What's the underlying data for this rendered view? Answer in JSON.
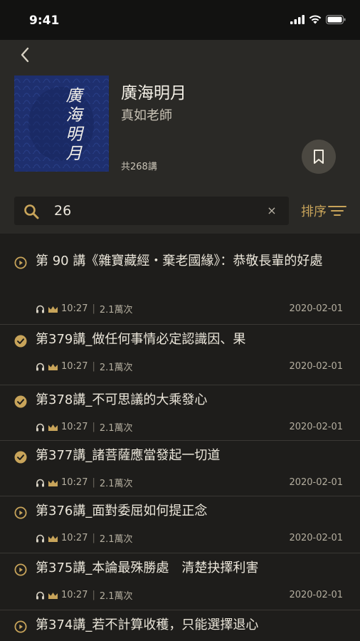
{
  "status": {
    "time": "9:41"
  },
  "album": {
    "title": "廣海明月",
    "author": "真如老師",
    "count": "共268講",
    "cover_text": "廣海明月"
  },
  "search": {
    "value": "26",
    "clear": "×",
    "sort_label": "排序"
  },
  "colors": {
    "accent": "#c8a45a",
    "background": "#1e1d1b",
    "header": "#2a2926",
    "cover": "#1e2f6e"
  },
  "episodes": [
    {
      "title": "第 90 講《雜寶藏經・棄老國緣》：恭敬長輩的好處",
      "duration": "10:27",
      "plays": "2.1萬次",
      "date": "2020-02-01",
      "status": "play"
    },
    {
      "title": "第379講_做任何事情必定認識因、果",
      "duration": "10:27",
      "plays": "2.1萬次",
      "date": "2020-02-01",
      "status": "done"
    },
    {
      "title": "第378講_不可思議的大乘發心",
      "duration": "10:27",
      "plays": "2.1萬次",
      "date": "2020-02-01",
      "status": "done"
    },
    {
      "title": "第377講_諸菩薩應當發起一切道",
      "duration": "10:27",
      "plays": "2.1萬次",
      "date": "2020-02-01",
      "status": "done"
    },
    {
      "title": "第376講_面對委屈如何提正念",
      "duration": "10:27",
      "plays": "2.1萬次",
      "date": "2020-02-01",
      "status": "play"
    },
    {
      "title": "第375講_本論最殊勝處　清楚抉擇利害",
      "duration": "10:27",
      "plays": "2.1萬次",
      "date": "2020-02-01",
      "status": "play"
    },
    {
      "title": "第374講_若不計算收穫，只能選擇退心",
      "duration": "",
      "plays": "",
      "date": "",
      "status": "play"
    }
  ]
}
